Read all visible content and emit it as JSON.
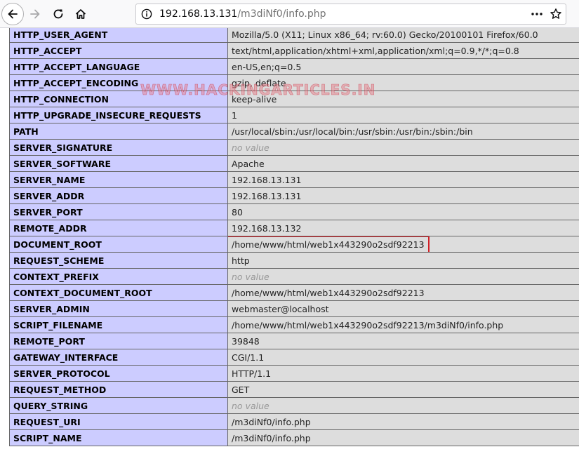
{
  "browser": {
    "url_host": "192.168.13.131",
    "url_path": "/m3diNf0/info.php",
    "icons": {
      "back": "back-arrow-icon",
      "forward": "forward-arrow-icon",
      "reload": "reload-icon",
      "home": "home-icon",
      "site_info": "info-icon",
      "page_actions": "more-dots-icon",
      "bookmark": "star-icon"
    }
  },
  "watermark": "WWW.HACKINGARTICLES.IN",
  "highlight_color": "#d21f26",
  "rows": [
    {
      "key": "HTTP_USER_AGENT",
      "value": "Mozilla/5.0 (X11; Linux x86_64; rv:60.0) Gecko/20100101 Firefox/60.0"
    },
    {
      "key": "HTTP_ACCEPT",
      "value": "text/html,application/xhtml+xml,application/xml;q=0.9,*/*;q=0.8"
    },
    {
      "key": "HTTP_ACCEPT_LANGUAGE",
      "value": "en-US,en;q=0.5"
    },
    {
      "key": "HTTP_ACCEPT_ENCODING",
      "value": "gzip, deflate"
    },
    {
      "key": "HTTP_CONNECTION",
      "value": "keep-alive"
    },
    {
      "key": "HTTP_UPGRADE_INSECURE_REQUESTS",
      "value": "1"
    },
    {
      "key": "PATH",
      "value": "/usr/local/sbin:/usr/local/bin:/usr/sbin:/usr/bin:/sbin:/bin"
    },
    {
      "key": "SERVER_SIGNATURE",
      "value": "no value"
    },
    {
      "key": "SERVER_SOFTWARE",
      "value": "Apache"
    },
    {
      "key": "SERVER_NAME",
      "value": "192.168.13.131"
    },
    {
      "key": "SERVER_ADDR",
      "value": "192.168.13.131"
    },
    {
      "key": "SERVER_PORT",
      "value": "80"
    },
    {
      "key": "REMOTE_ADDR",
      "value": "192.168.13.132"
    },
    {
      "key": "DOCUMENT_ROOT",
      "value": "/home/www/html/web1x443290o2sdf92213"
    },
    {
      "key": "REQUEST_SCHEME",
      "value": "http"
    },
    {
      "key": "CONTEXT_PREFIX",
      "value": "no value"
    },
    {
      "key": "CONTEXT_DOCUMENT_ROOT",
      "value": "/home/www/html/web1x443290o2sdf92213"
    },
    {
      "key": "SERVER_ADMIN",
      "value": "webmaster@localhost"
    },
    {
      "key": "SCRIPT_FILENAME",
      "value": "/home/www/html/web1x443290o2sdf92213/m3diNf0/info.php"
    },
    {
      "key": "REMOTE_PORT",
      "value": "39848"
    },
    {
      "key": "GATEWAY_INTERFACE",
      "value": "CGI/1.1"
    },
    {
      "key": "SERVER_PROTOCOL",
      "value": "HTTP/1.1"
    },
    {
      "key": "REQUEST_METHOD",
      "value": "GET"
    },
    {
      "key": "QUERY_STRING",
      "value": "no value"
    },
    {
      "key": "REQUEST_URI",
      "value": "/m3diNf0/info.php"
    },
    {
      "key": "SCRIPT_NAME",
      "value": "/m3diNf0/info.php"
    }
  ]
}
